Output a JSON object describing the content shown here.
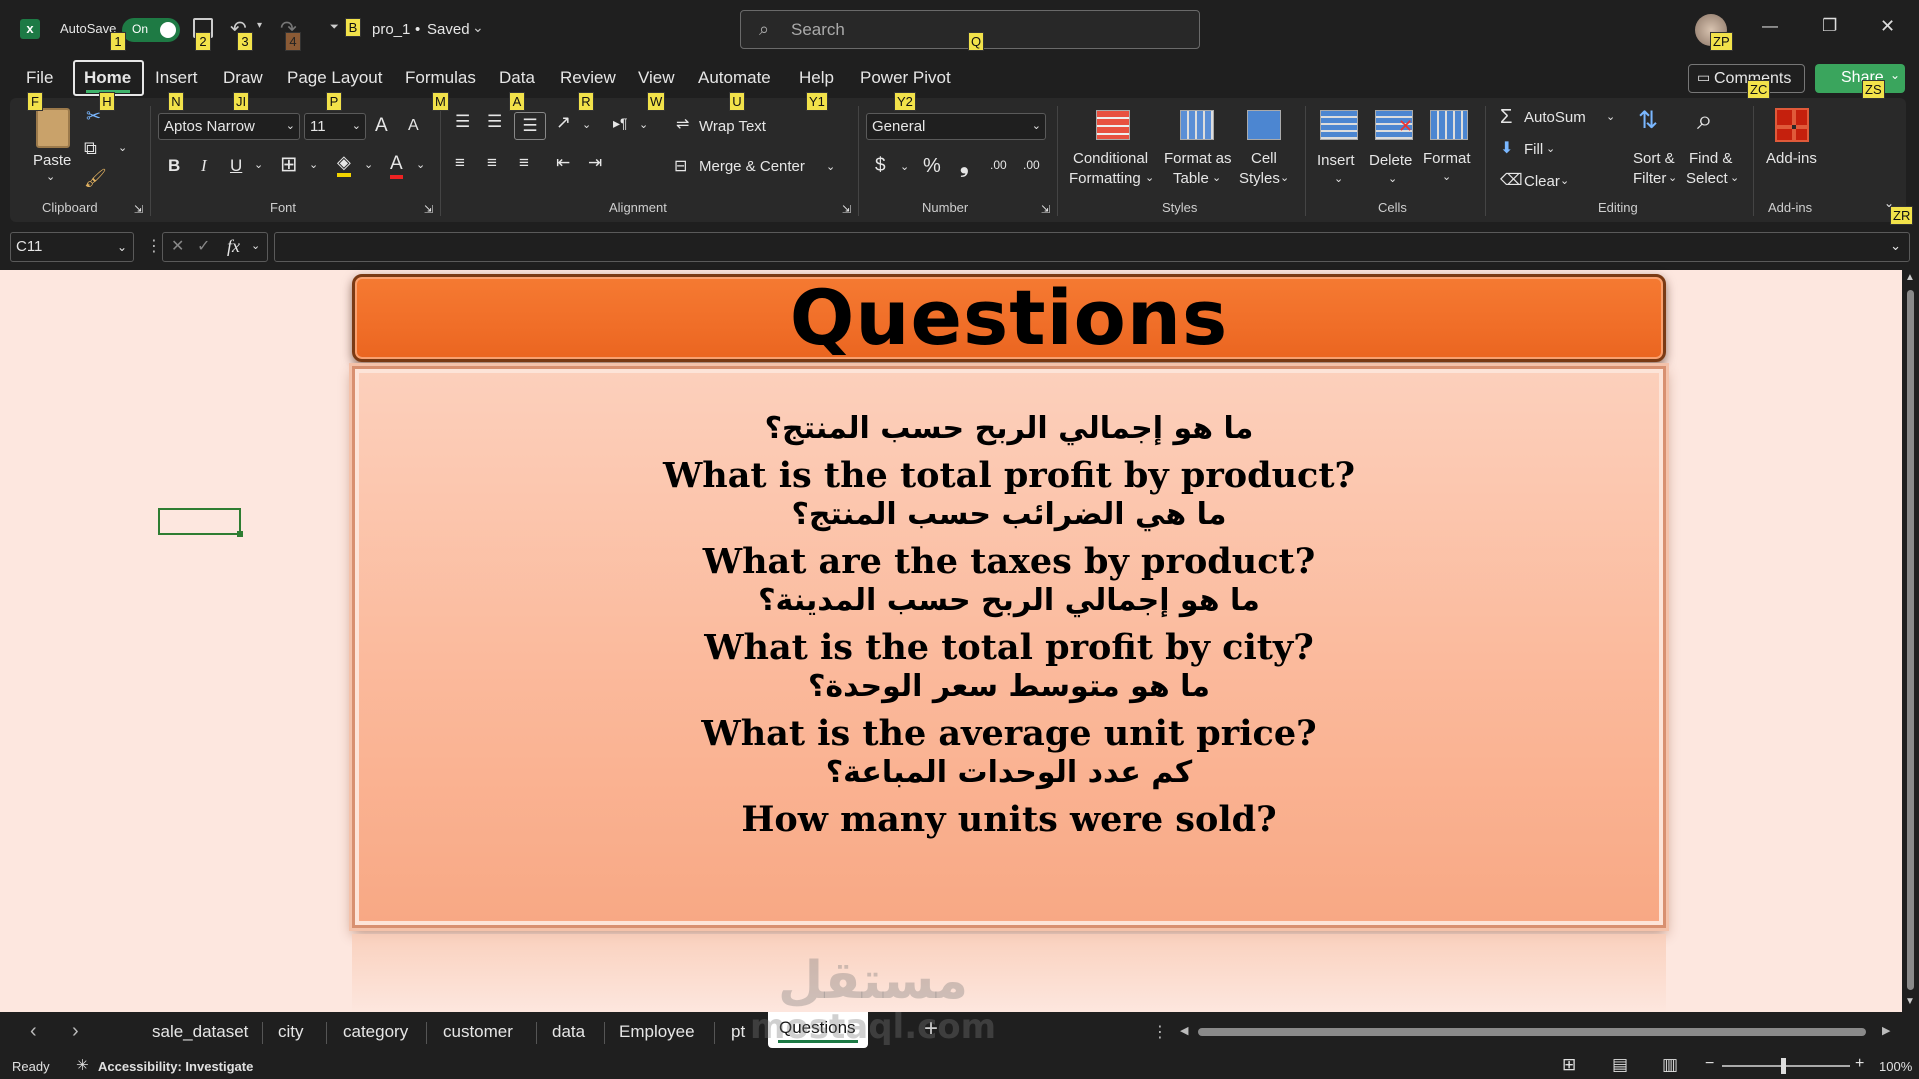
{
  "titlebar": {
    "autosave_label": "AutoSave",
    "autosave_state": "On",
    "filename": "pro_1",
    "status": "Saved",
    "search_placeholder": "Search",
    "keytips": [
      "1",
      "2",
      "3",
      "4",
      "B",
      "Q",
      "ZP"
    ],
    "minimize": "—",
    "restore": "❐",
    "close": "✕"
  },
  "tabs": [
    "File",
    "Home",
    "Insert",
    "Draw",
    "Page Layout",
    "Formulas",
    "Data",
    "Review",
    "View",
    "Automate",
    "Help",
    "Power Pivot"
  ],
  "tab_keytips": [
    "F",
    "H",
    "N",
    "JI",
    "P",
    "M",
    "A",
    "R",
    "W",
    "U",
    "Y1",
    "Y2"
  ],
  "comments_label": "Comments",
  "share_label": "Share",
  "comments_keytip": "ZC",
  "share_keytip": "ZS",
  "ribbon_keytip": "ZR",
  "ribbon": {
    "clipboard": {
      "paste": "Paste",
      "group": "Clipboard"
    },
    "font": {
      "name": "Aptos Narrow",
      "size": "11",
      "bold": "B",
      "italic": "I",
      "underline": "U",
      "grow": "A",
      "shrink": "A",
      "font_color": "A",
      "group": "Font"
    },
    "alignment": {
      "wrap": "Wrap Text",
      "merge": "Merge & Center",
      "group": "Alignment"
    },
    "number": {
      "format": "General",
      "currency": "$",
      "percent": "%",
      "comma": "❟",
      "inc_dec": ".00",
      "dec_dec": ".00",
      "group": "Number"
    },
    "styles": {
      "conditional": [
        "Conditional",
        "Formatting"
      ],
      "format_table": [
        "Format as",
        "Table"
      ],
      "cell_styles": [
        "Cell",
        "Styles"
      ],
      "group": "Styles"
    },
    "cells": {
      "insert": "Insert",
      "delete": "Delete",
      "format": "Format",
      "group": "Cells"
    },
    "editing": {
      "autosum": "AutoSum",
      "fill": "Fill",
      "clear": "Clear",
      "sort": [
        "Sort &",
        "Filter"
      ],
      "find": [
        "Find &",
        "Select"
      ],
      "group": "Editing"
    },
    "addins": {
      "label": "Add-ins",
      "group": "Add-ins"
    }
  },
  "formula_bar": {
    "name_box": "C11",
    "fx": "fx",
    "content": ""
  },
  "questions": {
    "title": "Questions",
    "lines": [
      {
        "lang": "ar",
        "text": "ما هو إجمالي الربح حسب المنتج؟"
      },
      {
        "lang": "en",
        "text": "What is the total profit by product?"
      },
      {
        "lang": "ar",
        "text": "ما هي الضرائب حسب المنتج؟"
      },
      {
        "lang": "en",
        "text": "What are the taxes by product?"
      },
      {
        "lang": "ar",
        "text": "ما هو إجمالي الربح حسب المدينة؟"
      },
      {
        "lang": "en",
        "text": "What is the total profit by city?"
      },
      {
        "lang": "ar",
        "text": "ما هو متوسط سعر الوحدة؟"
      },
      {
        "lang": "en",
        "text": "What is the average unit price?"
      },
      {
        "lang": "ar",
        "text": "كم عدد الوحدات المباعة؟"
      },
      {
        "lang": "en",
        "text": "How many units were sold?"
      }
    ]
  },
  "sheet_tabs": [
    "sale_dataset",
    "city",
    "category",
    "customer",
    "data",
    "Employee",
    "pt",
    "Questions"
  ],
  "active_sheet": "Questions",
  "watermark": [
    "مستقل",
    "mostaql.com"
  ],
  "status": {
    "ready": "Ready",
    "accessibility": "Accessibility: Investigate",
    "zoom": "100%"
  }
}
